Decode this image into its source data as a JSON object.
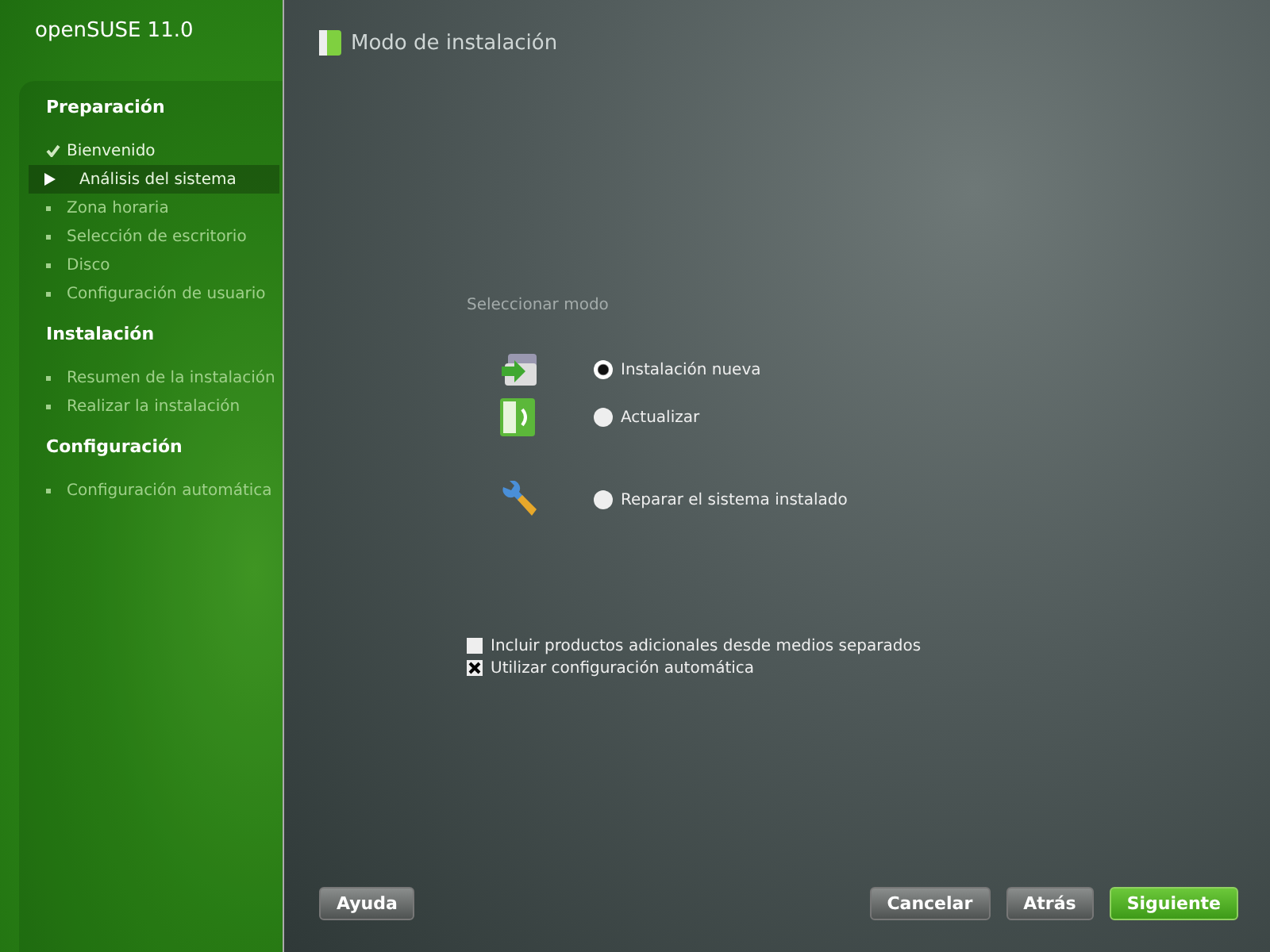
{
  "product": "openSUSE 11.0",
  "sidebar": [
    {
      "title": "Preparación",
      "steps": [
        {
          "label": "Bienvenido",
          "kind": "done"
        },
        {
          "label": "Análisis del sistema",
          "kind": "current"
        },
        {
          "label": "Zona horaria",
          "kind": "pending"
        },
        {
          "label": "Selección de escritorio",
          "kind": "pending"
        },
        {
          "label": "Disco",
          "kind": "pending"
        },
        {
          "label": "Configuración de usuario",
          "kind": "pending"
        }
      ]
    },
    {
      "title": "Instalación",
      "steps": [
        {
          "label": "Resumen de la instalación",
          "kind": "pending"
        },
        {
          "label": "Realizar la instalación",
          "kind": "pending"
        }
      ]
    },
    {
      "title": "Configuración",
      "steps": [
        {
          "label": "Configuración automática",
          "kind": "pending"
        }
      ]
    }
  ],
  "page_title": "Modo de instalación",
  "group_label": "Seleccionar modo",
  "modes": [
    {
      "label": "Instalación nueva",
      "kind": "new",
      "selected": true
    },
    {
      "label": "Actualizar",
      "kind": "update",
      "selected": false
    },
    {
      "label": "Reparar el sistema instalado",
      "kind": "repair",
      "selected": false
    }
  ],
  "options": [
    {
      "label": "Incluir productos adicionales desde medios separados",
      "checked": false
    },
    {
      "label": "Utilizar configuración automática",
      "checked": true
    }
  ],
  "buttons": [
    {
      "label": "Ayuda",
      "kind": "plain"
    },
    {
      "label": "Cancelar",
      "kind": "plain"
    },
    {
      "label": "Atrás",
      "kind": "plain"
    },
    {
      "label": "Siguiente",
      "kind": "primary"
    }
  ]
}
